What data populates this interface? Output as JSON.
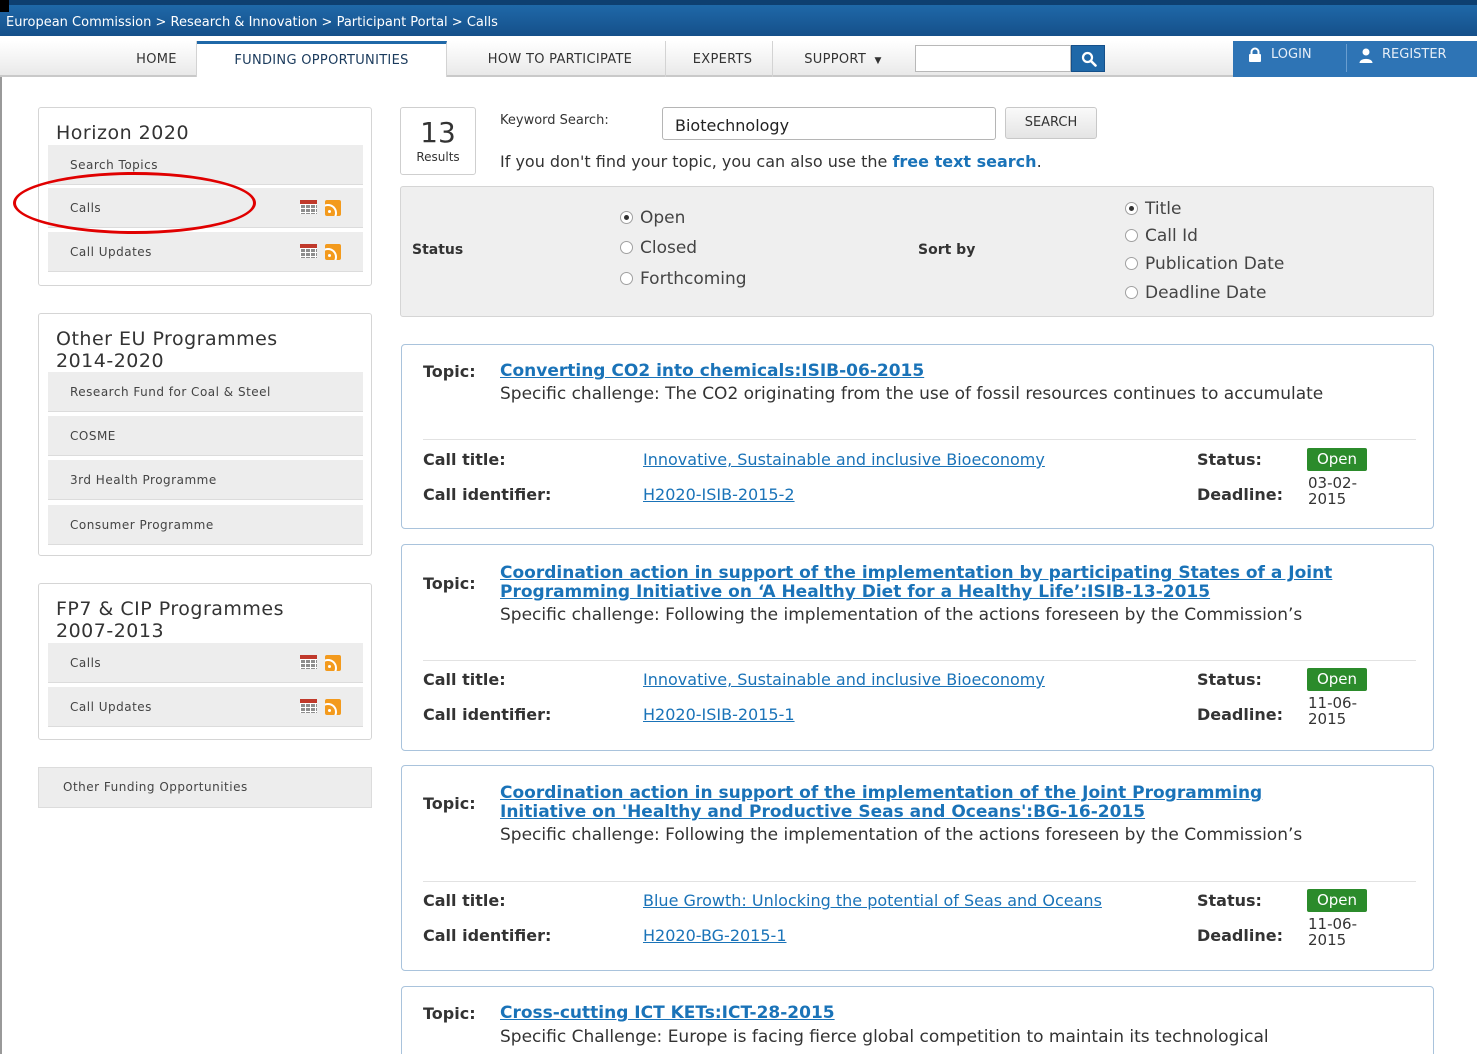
{
  "breadcrumb": [
    "European Commission >",
    "Research & Innovation >",
    "Participant Portal >",
    "Calls"
  ],
  "nav": {
    "home": "HOME",
    "funding": "FUNDING OPPORTUNITIES",
    "participate": "HOW TO PARTICIPATE",
    "experts": "EXPERTS",
    "support": "SUPPORT",
    "search_value": "",
    "login": "LOGIN",
    "register": "REGISTER"
  },
  "sidebar": {
    "horizon": {
      "title": "Horizon 2020",
      "items": [
        "Search Topics",
        "Calls",
        "Call Updates"
      ]
    },
    "other_eu": {
      "title_line1": "Other EU Programmes",
      "title_line2": "2014-2020",
      "items": [
        "Research Fund for Coal & Steel",
        "COSME",
        "3rd Health Programme",
        "Consumer Programme"
      ]
    },
    "fp7": {
      "title_line1": "FP7 & CIP Programmes",
      "title_line2": "2007-2013",
      "items": [
        "Calls",
        "Call Updates"
      ]
    },
    "other_funding": "Other Funding Opportunities"
  },
  "search": {
    "results_count": "13",
    "results_label": "Results",
    "keyword_label": "Keyword Search:",
    "keyword_value": "Biotechnology",
    "button": "SEARCH",
    "hint_prefix": "If you don't find your topic, you can also use the ",
    "hint_link": "free text search",
    "hint_suffix": "."
  },
  "filters": {
    "status_label": "Status",
    "status_options": [
      "Open",
      "Closed",
      "Forthcoming"
    ],
    "status_selected": "Open",
    "sort_label": "Sort by",
    "sort_options": [
      "Title",
      "Call Id",
      "Publication Date",
      "Deadline Date"
    ],
    "sort_selected": "Title"
  },
  "labels": {
    "topic": "Topic:",
    "call_title": "Call title:",
    "call_identifier": "Call identifier:",
    "status": "Status:",
    "deadline": "Deadline:"
  },
  "results": [
    {
      "title_line1": "Converting CO2 into chemicals:ISIB-06-2015",
      "title_line2": "",
      "challenge": "Specific challenge: The CO2 originating from the use of fossil resources continues to accumulate",
      "call_title": "Innovative, Sustainable and inclusive Bioeconomy",
      "call_id": "H2020-ISIB-2015-2",
      "status": "Open",
      "deadline_line1": "03-02-",
      "deadline_line2": "2015"
    },
    {
      "title_line1": "Coordination action in support of the implementation by participating States of a Joint",
      "title_line2": "Programming Initiative on ‘A Healthy Diet for a Healthy Life’:ISIB-13-2015",
      "challenge": "Specific challenge: Following the implementation of the actions foreseen by the Commission’s",
      "call_title": "Innovative, Sustainable and inclusive Bioeconomy",
      "call_id": "H2020-ISIB-2015-1",
      "status": "Open",
      "deadline_line1": "11-06-",
      "deadline_line2": "2015"
    },
    {
      "title_line1": "Coordination action in support of the implementation of the Joint Programming",
      "title_line2": "Initiative on 'Healthy and Productive Seas and Oceans':BG-16-2015",
      "challenge": "Specific challenge: Following the implementation of the actions foreseen by the Commission’s",
      "call_title": "Blue Growth: Unlocking the potential of Seas and Oceans",
      "call_id": "H2020-BG-2015-1",
      "status": "Open",
      "deadline_line1": "11-06-",
      "deadline_line2": "2015"
    },
    {
      "title_line1": "Cross-cutting ICT KETs:ICT-28-2015",
      "title_line2": "",
      "challenge": "Specific Challenge: Europe is facing fierce global competition to maintain its technological"
    }
  ],
  "colors": {
    "brand_blue": "#1f68a8",
    "link": "#1a73b8",
    "open_badge": "#2b8b2b",
    "annotation_red": "#e00000"
  }
}
